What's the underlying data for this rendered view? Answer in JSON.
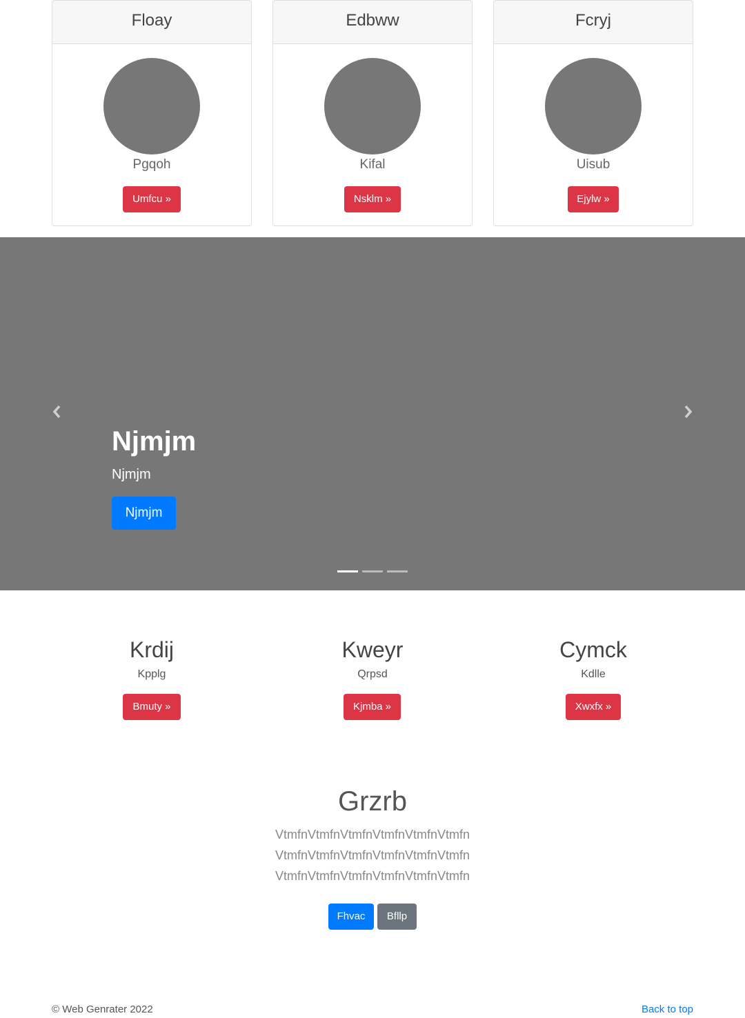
{
  "cards": [
    {
      "header": "Floay",
      "name": "Pgqoh",
      "button": "Umfcu »"
    },
    {
      "header": "Edbww",
      "name": "Kifal",
      "button": "Nsklm »"
    },
    {
      "header": "Fcryj",
      "name": "Uisub",
      "button": "Ejylw »"
    }
  ],
  "carousel": {
    "prev_icon": "chevron-left",
    "next_icon": "chevron-right",
    "title": "Njmjm",
    "subtitle": "Njmjm",
    "button": "Njmjm",
    "slide_count": 3,
    "active_slide": 1
  },
  "columns": [
    {
      "title": "Krdij",
      "text": "Kpplg",
      "button": "Bmuty »"
    },
    {
      "title": "Kweyr",
      "text": "Qrpsd",
      "button": "Kjmba »"
    },
    {
      "title": "Cymck",
      "text": "Kdlle",
      "button": "Xwxfx »"
    }
  ],
  "jumbotron": {
    "title": "Grzrb",
    "lines": [
      "VtmfnVtmfnVtmfnVtmfnVtmfnVtmfn",
      "VtmfnVtmfnVtmfnVtmfnVtmfnVtmfn",
      "VtmfnVtmfnVtmfnVtmfnVtmfnVtmfn"
    ],
    "primary_button": "Fhvac",
    "secondary_button": "Bfllp"
  },
  "footer": {
    "copyright": "© Web Genrater 2022",
    "back_to_top": "Back to top"
  },
  "colors": {
    "danger": "#dc3545",
    "primary": "#007bff",
    "secondary": "#6c757d",
    "placeholder": "#777777"
  }
}
